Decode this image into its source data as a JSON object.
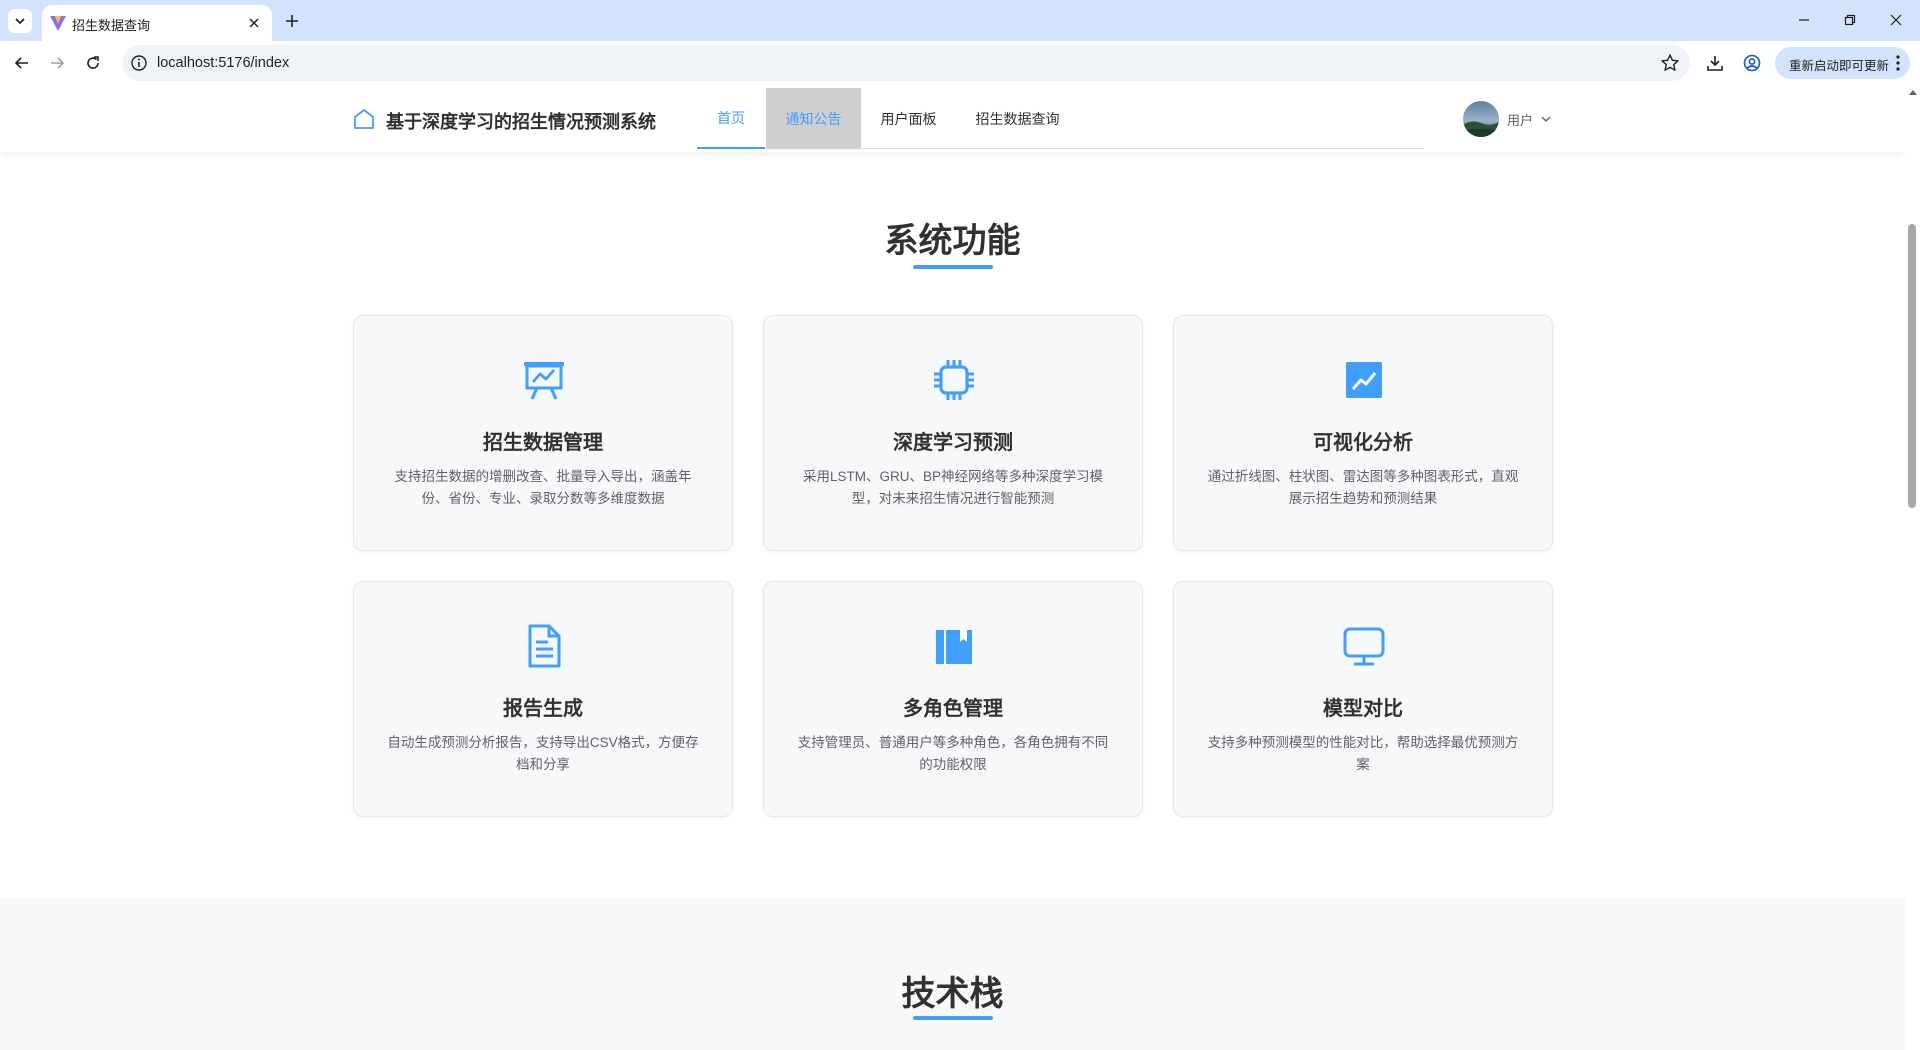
{
  "browser": {
    "tab_title": "招生数据查询",
    "url": "localhost:5176/index",
    "update_button": "重新启动即可更新"
  },
  "header": {
    "brand": "基于深度学习的招生情况预测系统",
    "nav": [
      "首页",
      "通知公告",
      "用户面板",
      "招生数据查询"
    ],
    "active_nav": "首页",
    "hovered_nav": "通知公告",
    "user": "用户"
  },
  "features": {
    "title": "系统功能",
    "cards": [
      {
        "icon": "presentation-chart-icon",
        "title": "招生数据管理",
        "desc": "支持招生数据的增删改查、批量导入导出，涵盖年份、省份、专业、录取分数等多维度数据"
      },
      {
        "icon": "cpu-chip-icon",
        "title": "深度学习预测",
        "desc": "采用LSTM、GRU、BP神经网络等多种深度学习模型，对未来招生情况进行智能预测"
      },
      {
        "icon": "trend-chart-icon",
        "title": "可视化分析",
        "desc": "通过折线图、柱状图、雷达图等多种图表形式，直观展示招生趋势和预测结果"
      },
      {
        "icon": "document-icon",
        "title": "报告生成",
        "desc": "自动生成预测分析报告，支持导出CSV格式，方便存档和分享"
      },
      {
        "icon": "collection-icon",
        "title": "多角色管理",
        "desc": "支持管理员、普通用户等多种角色，各角色拥有不同的功能权限"
      },
      {
        "icon": "monitor-icon",
        "title": "模型对比",
        "desc": "支持多种预测模型的性能对比，帮助选择最优预测方案"
      }
    ]
  },
  "tech": {
    "title": "技术栈"
  },
  "colors": {
    "accent": "#409eff",
    "browser_chrome": "#d3e3fd",
    "card_bg": "#f7f8fa"
  }
}
